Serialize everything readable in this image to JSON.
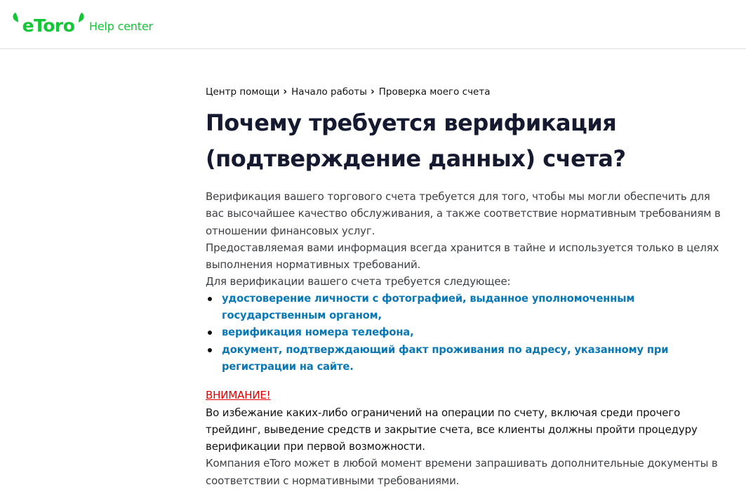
{
  "header": {
    "logo_text": "eToro",
    "help_center": "Help center",
    "brand_color": "#13c636"
  },
  "breadcrumb": [
    {
      "label": "Центр помощи"
    },
    {
      "label": "Начало работы"
    },
    {
      "label": "Проверка моего счета"
    }
  ],
  "breadcrumb_separator": "›",
  "article": {
    "title_line1": "Почему требуется верификация",
    "title_line2": "(подтверждение данных) счета?",
    "intro": "Верификация вашего торгового счета требуется для того, чтобы мы могли обеспечить для вас высочайшее качество обслуживания, а также соответствие нормативным требованиям в отношении финансовых услуг.",
    "privacy": "Предоставляемая вами информация всегда хранится в тайне и используется только в целях выполнения нормативных требований.",
    "requirements_intro": "Для верификации вашего счета требуется следующее:",
    "requirements": [
      {
        "text": "удостоверение личности с фотографией, выданное уполномоченным государственным органом,"
      },
      {
        "text": "верификация номера телефона,"
      },
      {
        "text": "документ, подтверждающий факт проживания по адресу, указанному при регистрации на сайте."
      }
    ],
    "warning_title": "ВНИМАНИЕ!",
    "warning_text": "Во избежание каких-либо ограничений на операции по счету, включая среди прочего трейдинг, выведение средств и закрытие счета, все клиенты должны пройти процедуру верификации при первой возможности.",
    "closing": "Компания eToro может в любой момент времени запрашивать дополнительные документы в соответствии с нормативными требованиями."
  },
  "colors": {
    "link": "#0a78b4",
    "warning": "#e00000",
    "title": "#151a30"
  }
}
